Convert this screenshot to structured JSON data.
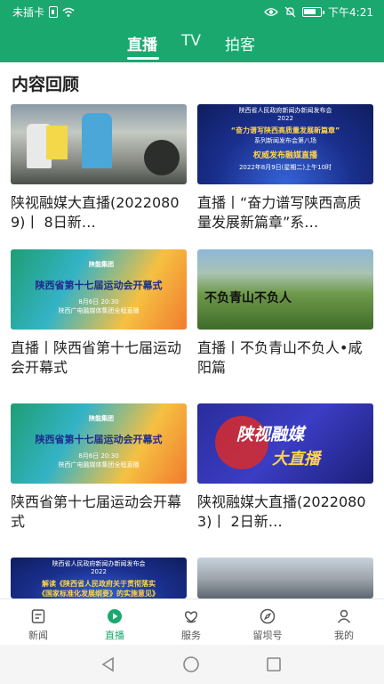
{
  "status_bar": {
    "carrier": "未插卡",
    "time": "下午4:21",
    "icons": [
      "sim-icon",
      "wifi-icon",
      "eye-icon",
      "bell-off-icon",
      "battery-icon"
    ]
  },
  "top_tabs": [
    {
      "label": "直播",
      "active": true
    },
    {
      "label": "TV",
      "active": false
    },
    {
      "label": "拍客",
      "active": false
    }
  ],
  "section": {
    "title": "内容回顾"
  },
  "cards": [
    {
      "title": "陕视融媒大直播(20220809)丨 8日新…",
      "thumb": {
        "type": "street-photo"
      }
    },
    {
      "title": "直播丨“奋力谱写陕西高质量发展新篇章”系…",
      "thumb": {
        "type": "press-banner",
        "line1": "陕西省人民政府新闻办新闻发布会",
        "line2": "2022",
        "line3": "“奋力谱写陕西高质量发展新篇章”",
        "line4": "系列新闻发布会第八场",
        "line5": "权威发布融媒直播",
        "line6": "2022年8月9日(星期二)上午10时"
      }
    },
    {
      "title": "直播丨陕西省第十七届运动会开幕式",
      "thumb": {
        "type": "sports-banner",
        "logo": "陕能集团",
        "headline": "陕西省第十七届运动会开幕式",
        "date": "8月6日 20:30",
        "channel": "陕西广电融媒体集团全程直播"
      }
    },
    {
      "title": "直播丨不负青山不负人•咸阳篇",
      "thumb": {
        "type": "mountain-photo",
        "calligraphy": "不负青山不负人"
      }
    },
    {
      "title": "陕西省第十七届运动会开幕式",
      "thumb": {
        "type": "sports-banner",
        "logo": "陕能集团",
        "headline": "陕西省第十七届运动会开幕式",
        "date": "8月6日 20:30",
        "channel": "陕西广电融媒体集团全程直播"
      }
    },
    {
      "title": "陕视融媒大直播(20220803)丨 2日新…",
      "thumb": {
        "type": "brand-banner",
        "line1": "陕视融媒",
        "line2": "大直播"
      }
    },
    {
      "title": "",
      "thumb": {
        "type": "press-banner-2",
        "line1": "陕西省人民政府新闻办新闻发布会",
        "line2": "2022",
        "line3": "解读《陕西省人民政府关于贯彻落实",
        "line4": "《国家标准化发展纲要》的实施意见》"
      }
    },
    {
      "title": "",
      "thumb": {
        "type": "people-photo"
      }
    }
  ],
  "bottom_nav": [
    {
      "label": "新闻",
      "icon": "news-icon",
      "active": false
    },
    {
      "label": "直播",
      "icon": "live-play-icon",
      "active": true
    },
    {
      "label": "服务",
      "icon": "service-heart-icon",
      "active": false
    },
    {
      "label": "留坝号",
      "icon": "compass-icon",
      "active": false
    },
    {
      "label": "我的",
      "icon": "profile-icon",
      "active": false
    }
  ],
  "colors": {
    "brand_green": "#1aa86f",
    "text": "#222222",
    "inactive_nav": "#555555"
  }
}
